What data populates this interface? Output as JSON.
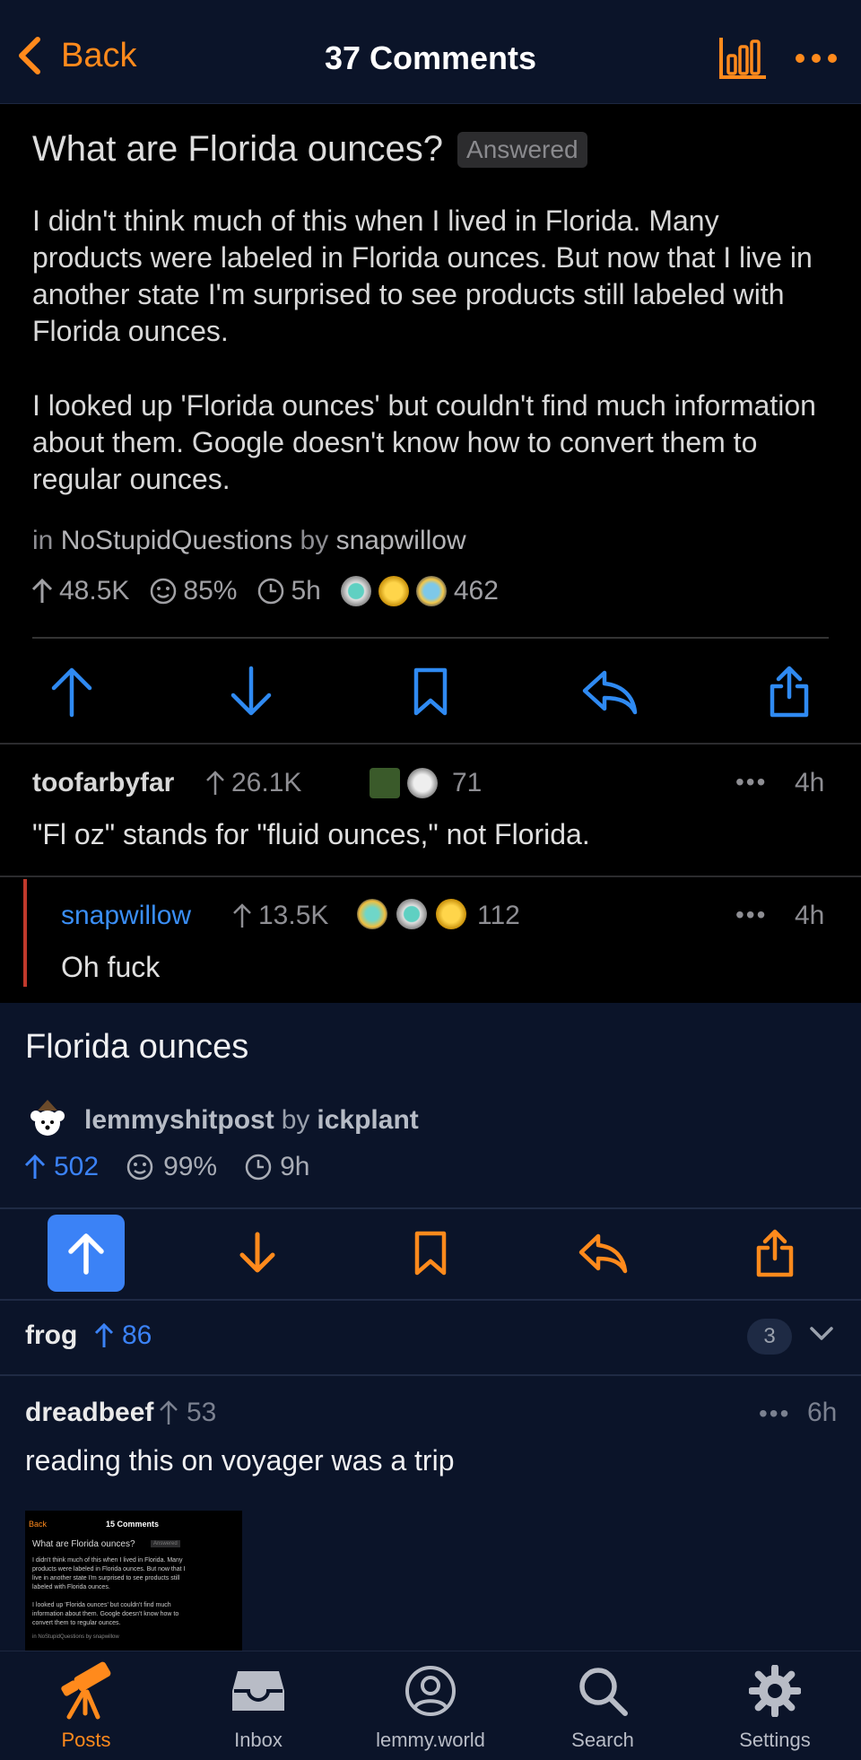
{
  "nav": {
    "back_label": "Back",
    "title": "37 Comments"
  },
  "screenshot": {
    "post": {
      "title": "What are Florida ounces?",
      "badge": "Answered",
      "body": [
        "I didn't think much of this when I lived in Florida. Many products were labeled in Florida ounces. But now that I live in another state I'm surprised to see products still labeled with Florida ounces.",
        "I looked up 'Florida ounces' but couldn't find much information about them. Google doesn't know how to convert them to regular ounces."
      ],
      "meta_in": "in",
      "community": "NoStupidQuestions",
      "meta_by": "by",
      "author": "snapwillow",
      "score": "48.5K",
      "ratio": "85%",
      "age": "5h",
      "awards_count": "462"
    },
    "comments": [
      {
        "author": "toofarbyfar",
        "score": "26.1K",
        "awards_count": "71",
        "time": "4h",
        "text": "\"Fl oz\" stands for \"fluid ounces,\" not Florida."
      },
      {
        "author": "snapwillow",
        "score": "13.5K",
        "awards_count": "112",
        "time": "4h",
        "text": "Oh fuck"
      }
    ]
  },
  "post": {
    "title": "Florida ounces",
    "community": "lemmyshitpost",
    "by": "by",
    "author": "ickplant",
    "score": "502",
    "ratio": "99%",
    "age": "9h"
  },
  "thread": {
    "collapsed_author": "frog",
    "collapsed_score": "86",
    "collapsed_replies": "3",
    "comment": {
      "author": "dreadbeef",
      "score": "53",
      "time": "6h",
      "text": "reading this on voyager was a trip"
    }
  },
  "thumbnail": {
    "back": "Back",
    "title": "15 Comments",
    "post_title": "What are Florida ounces?",
    "badge": "Answered",
    "line1": "I didn't think much of this when I lived in Florida. Many",
    "line2": "products were labeled in Florida ounces. But now that I",
    "line3": "live in another state I'm surprised to see products still",
    "line4": "labeled with Florida ounces.",
    "line5": "I looked up 'Florida ounces' but couldn't find much",
    "line6": "information about them. Google doesn't know how to",
    "line7": "convert them to regular ounces.",
    "line8": "in NoStupidQuestions by snapwillow"
  },
  "tabs": [
    {
      "label": "Posts",
      "icon": "telescope-icon",
      "active": true
    },
    {
      "label": "Inbox",
      "icon": "inbox-icon",
      "active": false
    },
    {
      "label": "lemmy.world",
      "icon": "account-icon",
      "active": false
    },
    {
      "label": "Search",
      "icon": "search-icon",
      "active": false
    },
    {
      "label": "Settings",
      "icon": "gear-icon",
      "active": false
    }
  ],
  "colors": {
    "accent": "#ff8a1c",
    "upvote_blue": "#3b82f6",
    "background": "#0b1429",
    "screenshot_bg": "#000000",
    "reply_bar": "#c0392b"
  }
}
